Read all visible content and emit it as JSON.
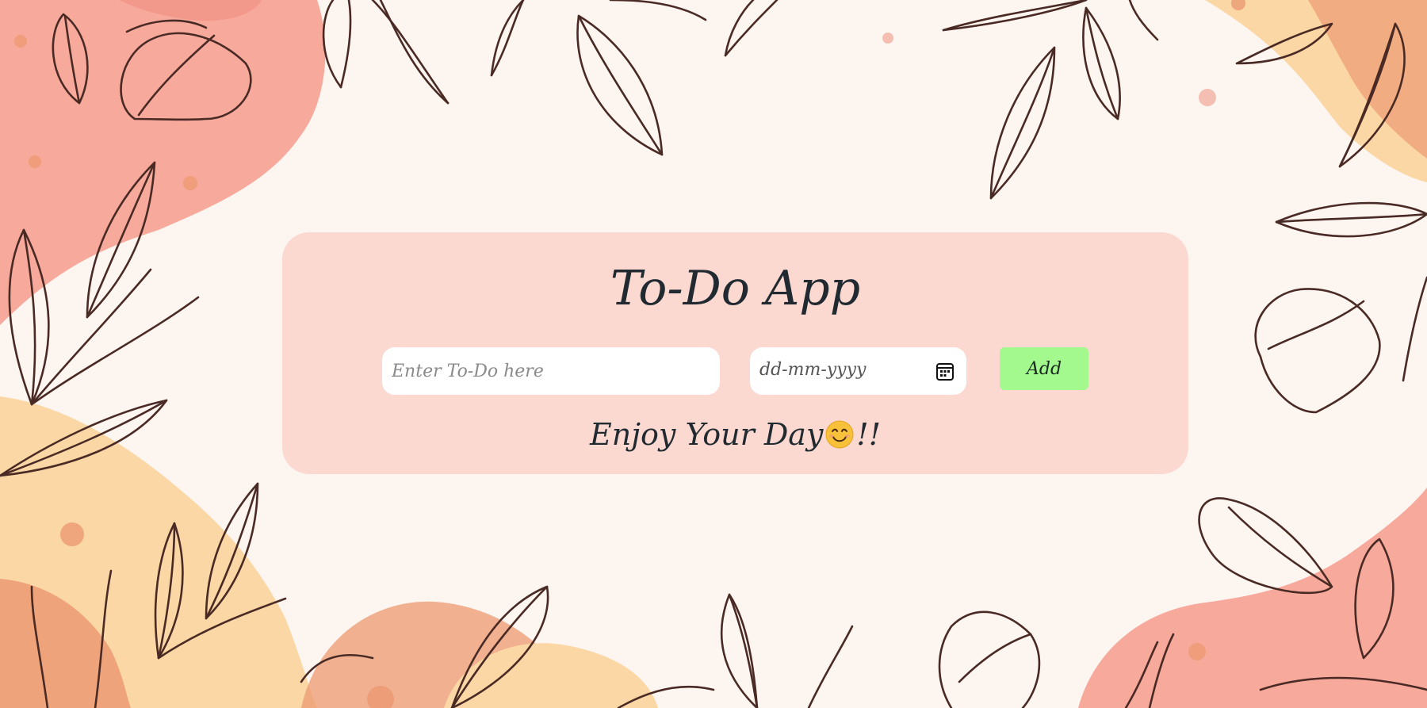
{
  "app": {
    "title": "To-Do App"
  },
  "form": {
    "todo_placeholder": "Enter To-Do here",
    "todo_value": "",
    "date_placeholder": "dd-mm-yyyy",
    "add_label": "Add"
  },
  "tagline": {
    "text": "Enjoy Your Day",
    "suffix": "!!",
    "emoji": "smiling-face-emoji"
  },
  "icons": {
    "calendar": "calendar-icon"
  },
  "colors": {
    "background": "#fdf5f0",
    "card": "#fbd9d1",
    "add_button": "#a3f98e",
    "text": "#222a31",
    "blob_pink": "#f7a99c",
    "blob_peach": "#fbd7a5",
    "blob_orange": "#ec9a72",
    "line_art": "#4a2a24"
  }
}
